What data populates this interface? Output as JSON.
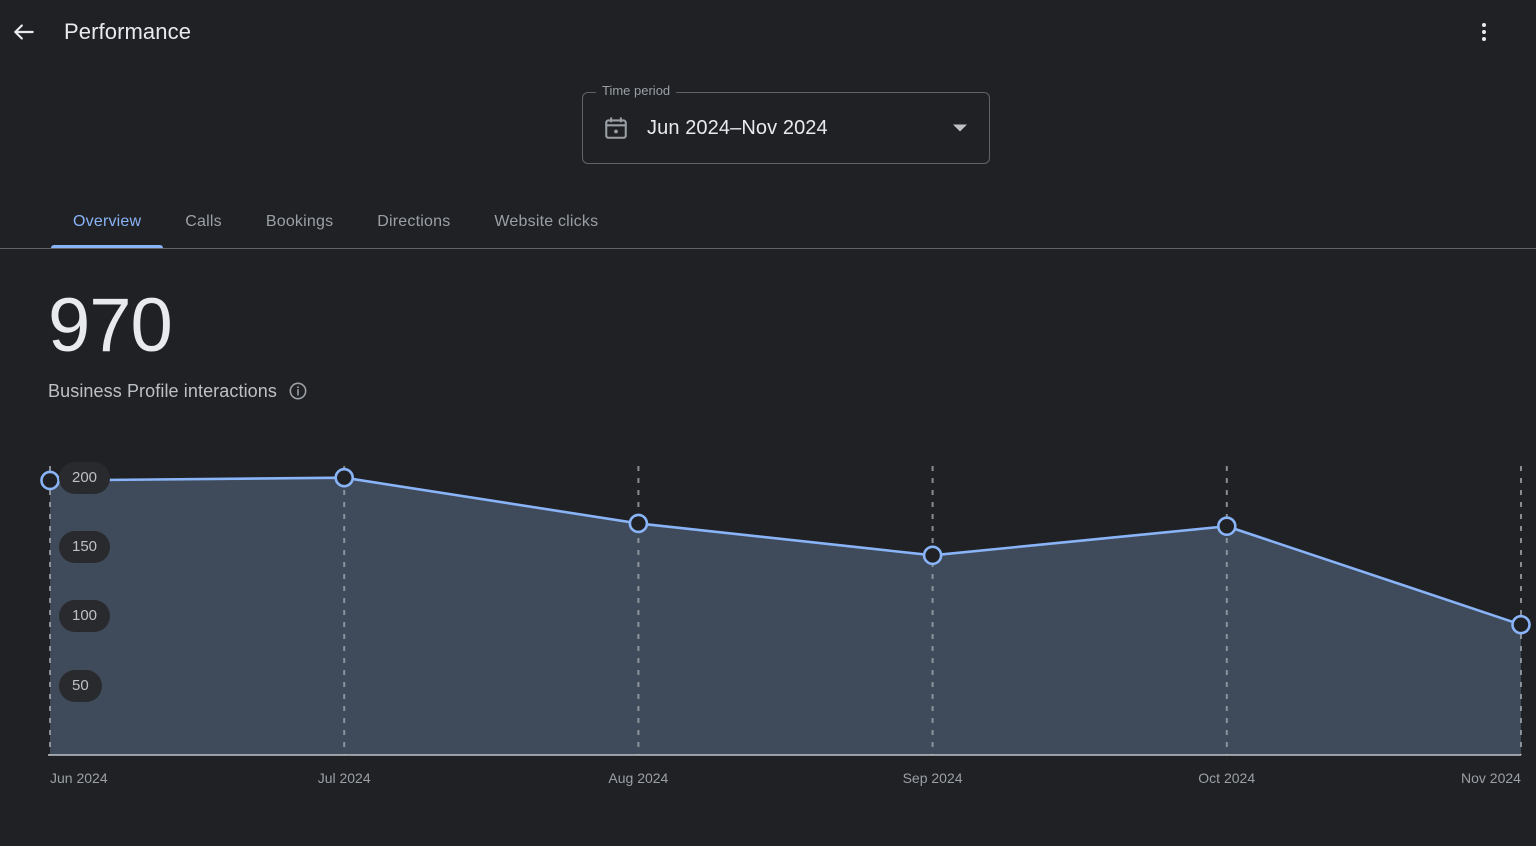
{
  "header": {
    "title": "Performance",
    "back_icon": "arrow-back-icon",
    "overflow_icon": "more-vert-icon"
  },
  "time_period": {
    "legend": "Time period",
    "value": "Jun 2024–Nov 2024",
    "calendar_icon": "calendar-event-icon",
    "dropdown_icon": "chevron-down-icon"
  },
  "tabs": [
    {
      "label": "Overview",
      "active": true
    },
    {
      "label": "Calls",
      "active": false
    },
    {
      "label": "Bookings",
      "active": false
    },
    {
      "label": "Directions",
      "active": false
    },
    {
      "label": "Website clicks",
      "active": false
    }
  ],
  "kpi": {
    "value": "970",
    "label": "Business Profile interactions",
    "info_icon": "info-outline-icon"
  },
  "colors": {
    "background": "#202124",
    "accent": "#8ab4f8",
    "area_fill": "#3f4a5a",
    "pill_background": "#292a2d",
    "text_primary": "#e8eaed",
    "text_secondary": "#9aa0a6",
    "gridline": "#9aa0a6"
  },
  "chart_data": {
    "type": "area",
    "title": "Business Profile interactions",
    "xlabel": "",
    "ylabel": "",
    "categories": [
      "Jun 2024",
      "Jul 2024",
      "Aug 2024",
      "Sep 2024",
      "Oct 2024",
      "Nov 2024"
    ],
    "values": [
      198,
      200,
      167,
      144,
      165,
      94
    ],
    "series": [
      {
        "name": "Business Profile interactions",
        "values": [
          198,
          200,
          167,
          144,
          165,
          94
        ]
      }
    ],
    "ytick_labels": [
      "200",
      "150",
      "100",
      "50"
    ],
    "yticks": [
      200,
      150,
      100,
      50
    ],
    "ylim": [
      0,
      207
    ],
    "grid": "vertical-dashed",
    "legend": "none",
    "total": 970
  }
}
